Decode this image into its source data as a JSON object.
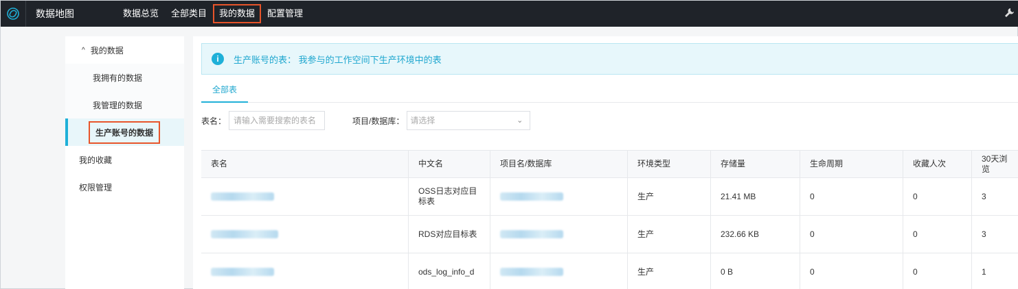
{
  "app": {
    "title": "数据地图"
  },
  "nav": [
    {
      "label": "数据总览",
      "active": false
    },
    {
      "label": "全部类目",
      "active": false
    },
    {
      "label": "我的数据",
      "active": true
    },
    {
      "label": "配置管理",
      "active": false
    }
  ],
  "sidebar": {
    "group_label": "我的数据",
    "sub_items": [
      "我拥有的数据",
      "我管理的数据",
      "生产账号的数据"
    ],
    "items": [
      "我的收藏",
      "权限管理"
    ]
  },
  "notice": {
    "text": "生产账号的表： 我参与的工作空间下生产环境中的表"
  },
  "tabs": [
    {
      "label": "全部表"
    }
  ],
  "filters": {
    "table_label": "表名：",
    "table_placeholder": "请输入需要搜索的表名",
    "project_label": "项目/数据库：",
    "project_placeholder": "请选择"
  },
  "table": {
    "headers": [
      "表名",
      "中文名",
      "项目名/数据库",
      "环境类型",
      "存储量",
      "生命周期",
      "收藏人次",
      "30天浏览"
    ],
    "rows": [
      {
        "cn_name": "OSS日志对应目标表",
        "env": "生产",
        "storage": "21.41 MB",
        "lifecycle": "0",
        "favorites": "0",
        "views": "3"
      },
      {
        "cn_name": "RDS对应目标表",
        "env": "生产",
        "storage": "232.66 KB",
        "lifecycle": "0",
        "favorites": "0",
        "views": "3"
      },
      {
        "cn_name": "ods_log_info_d",
        "env": "生产",
        "storage": "0 B",
        "lifecycle": "0",
        "favorites": "0",
        "views": "1"
      }
    ]
  }
}
